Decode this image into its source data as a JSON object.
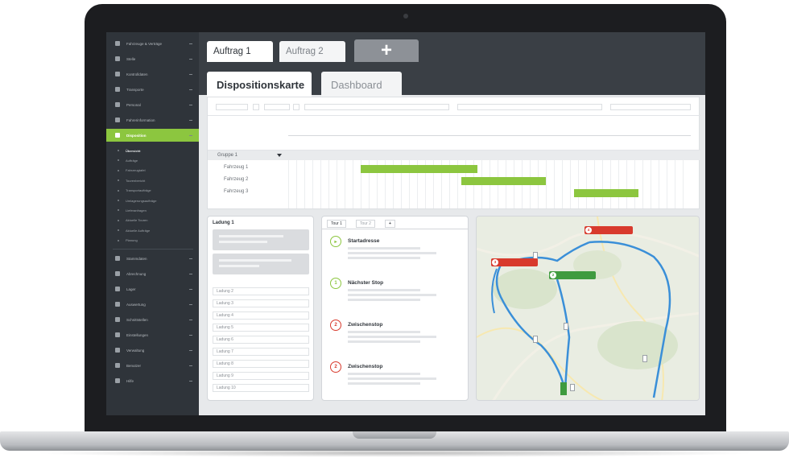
{
  "order_tabs": [
    "Auftrag 1",
    "Auftrag 2"
  ],
  "add_tab_symbol": "+",
  "view_tabs": [
    "Dispositionskarte",
    "Dashboard"
  ],
  "sidebar": {
    "items_top": [
      {
        "label": "Fahrzeuge & Verträge",
        "icon": "checkbox-icon"
      },
      {
        "label": "Stelle",
        "icon": "grid-icon"
      },
      {
        "label": "Kontrolldaten",
        "icon": "list-icon"
      },
      {
        "label": "Transporte",
        "icon": "truck-icon"
      },
      {
        "label": "Personal",
        "icon": "person-icon"
      },
      {
        "label": "Fahrerinformation",
        "icon": "home-icon"
      },
      {
        "label": "Disposition",
        "icon": "route-icon",
        "active": true
      }
    ],
    "subitems": [
      {
        "label": "Übersicht",
        "current": true
      },
      {
        "label": "Aufträge"
      },
      {
        "label": "Fahrzeugtafel"
      },
      {
        "label": "Tourenbericht"
      },
      {
        "label": "Transportaufträge"
      },
      {
        "label": "Umlagerungsaufträge"
      },
      {
        "label": "Lieferanfragen"
      },
      {
        "label": "Aktuelle Touren"
      },
      {
        "label": "Aktuelle Aufträge"
      },
      {
        "label": "Planung"
      }
    ],
    "items_bottom": [
      {
        "label": "Stammdaten",
        "icon": "database-icon"
      },
      {
        "label": "Abrechnung",
        "icon": "person-icon"
      },
      {
        "label": "Lager",
        "icon": "truck-icon"
      },
      {
        "label": "Auswertung",
        "icon": "person-icon"
      },
      {
        "label": "Schnittstellen",
        "icon": "car-icon"
      },
      {
        "label": "Einstellungen",
        "icon": "settings-icon"
      },
      {
        "label": "Verwaltung",
        "icon": "admin-icon"
      },
      {
        "label": "Benutzer",
        "icon": "user-icon"
      },
      {
        "label": "Hilfe",
        "icon": "help-icon"
      }
    ]
  },
  "gantt": {
    "group": "Gruppe 1",
    "vehicles": [
      "Fahrzeug 1",
      "Fahrzeug 2",
      "Fahrzeug 3"
    ],
    "bars": [
      {
        "row": 0,
        "start": 0.18,
        "end": 0.47
      },
      {
        "row": 1,
        "start": 0.43,
        "end": 0.64
      },
      {
        "row": 2,
        "start": 0.71,
        "end": 0.87
      }
    ]
  },
  "loads": {
    "title": "Ladung 1",
    "rows": [
      "Ladung 2",
      "Ladung 3",
      "Ladung 4",
      "Ladung 5",
      "Ladung 6",
      "Ladung 7",
      "Ladung 8",
      "Ladung 9",
      "Ladung 10"
    ]
  },
  "tour": {
    "tabs": [
      "Tour 1",
      "Tour 2",
      "+"
    ],
    "stops": [
      {
        "marker": "▸",
        "label": "Startadresse",
        "color": "green"
      },
      {
        "marker": "1",
        "label": "Nächster Stop",
        "color": "green"
      },
      {
        "marker": "2",
        "label": "Zwischenstop",
        "color": "red"
      },
      {
        "marker": "2",
        "label": "Zwischenstop",
        "color": "red"
      }
    ]
  },
  "map": {
    "pins": [
      {
        "num": "4",
        "color": "red"
      },
      {
        "num": "3",
        "color": "red"
      },
      {
        "num": "2",
        "color": "green"
      }
    ]
  },
  "colors": {
    "accent_green": "#8cc63f",
    "sidebar_bg": "#2f343a",
    "route_blue": "#3a8fd8",
    "stop_red": "#d83a2d"
  }
}
